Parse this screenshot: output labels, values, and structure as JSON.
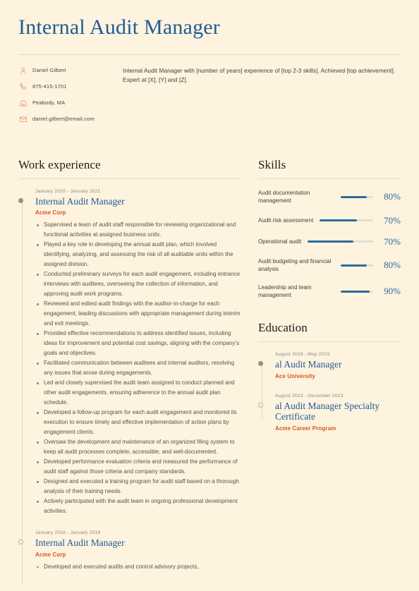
{
  "header": {
    "title": "Internal Audit Manager"
  },
  "contact": {
    "items": [
      {
        "icon": "person-icon",
        "text": "Daniel Gilbert"
      },
      {
        "icon": "phone-icon",
        "text": "875-415-1701"
      },
      {
        "icon": "location-icon",
        "text": "Peabody, MA"
      },
      {
        "icon": "email-icon",
        "text": "daniel.gilbert@email.com"
      }
    ]
  },
  "summary": {
    "text": "Internal Audit Manager with [number of years] experience of [top 2-3 skills]. Achieved [top achievement]. Expert at [X], [Y] and [Z]."
  },
  "work_experience": {
    "title": "Work experience",
    "entries": [
      {
        "date": "January 2020 - January 2021",
        "role": "Internal Audit Manager",
        "org": "Acme Corp",
        "marker": "filled",
        "points": [
          "Supervised a team of audit staff responsible for reviewing organizational and functional activities at assigned business units.",
          "Played a key role in developing the annual audit plan, which involved identifying, analyzing, and assessing the risk of all auditable units within the assigned division.",
          "Conducted preliminary surveys for each audit engagement, including entrance interviews with auditees, overseeing the collection of information, and approving audit work programs.",
          "Reviewed and edited audit findings with the auditor-in-charge for each engagement, leading discussions with appropriate management during interim and exit meetings.",
          "Provided effective recommendations to address identified issues, including ideas for improvement and potential cost savings, aligning with the company's goals and objectives.",
          "Facilitated communication between auditees and internal auditors, resolving any issues that arose during engagements.",
          "Led and closely supervised the audit team assigned to conduct planned and other audit engagements, ensuring adherence to the annual audit plan schedule.",
          "Developed a follow-up program for each audit engagement and monitored its execution to ensure timely and effective implementation of action plans by engagement clients.",
          "Oversaw the development and maintenance of an organized filing system to keep all audit processes complete, accessible, and well-documented.",
          "Developed performance evaluation criteria and measured the performance of audit staff against those criteria and company standards.",
          "Designed and executed a training program for audit staff based on a thorough analysis of their training needs.",
          "Actively participated with the audit team in ongoing professional development activities."
        ]
      },
      {
        "date": "January 2018 - January 2019",
        "role": "Internal Audit Manager",
        "org": "Acme Corp",
        "marker": "hollow",
        "points": [
          "Developed and executed audits and control advisory projects,"
        ]
      }
    ]
  },
  "skills": {
    "title": "Skills",
    "items": [
      {
        "label": "Audit documentation management",
        "percent": 80,
        "percent_label": "80%"
      },
      {
        "label": "Audit risk assessment",
        "percent": 70,
        "percent_label": "70%"
      },
      {
        "label": "Operational audit",
        "percent": 70,
        "percent_label": "70%"
      },
      {
        "label": "Audit budgeting and financial analysis",
        "percent": 80,
        "percent_label": "80%"
      },
      {
        "label": "Leadership and team management",
        "percent": 90,
        "percent_label": "90%"
      }
    ]
  },
  "education": {
    "title": "Education",
    "entries": [
      {
        "date": "August 2019 - May 2023",
        "degree": "al Audit Manager",
        "org": "Ace University",
        "marker": "filled"
      },
      {
        "date": "August 2023 - December 2023",
        "degree": "al Audit Manager Specialty Certificate",
        "org": "Acme Career Program",
        "marker": "hollow"
      }
    ]
  },
  "colors": {
    "background": "#FDF3DE",
    "accent_blue": "#1F5C99",
    "accent_orange": "#D9541E",
    "bar_blue": "#2E6A9E",
    "rule": "#E6DCC4",
    "body_text": "#55534E",
    "muted_text": "#8C8A85"
  }
}
